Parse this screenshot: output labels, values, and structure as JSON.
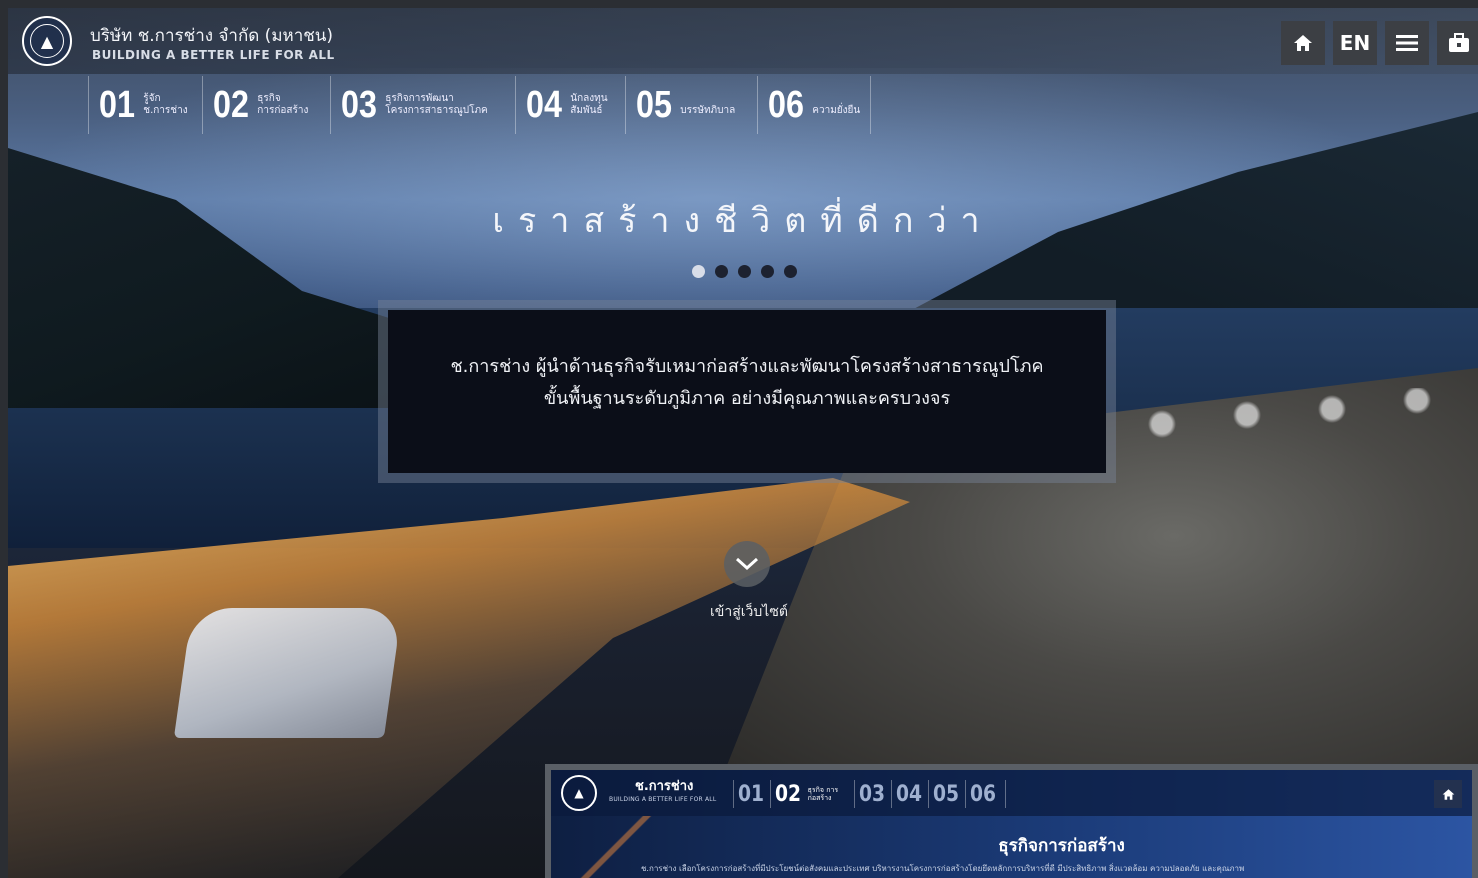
{
  "header": {
    "company_name": "บริษัท ช.การช่าง จำกัด (มหาชน)",
    "tagline": "BUILDING A BETTER LIFE FOR ALL",
    "buttons": {
      "home_icon": "home-icon",
      "lang": "EN",
      "menu_icon": "menu-icon",
      "extra_icon": "briefcase-icon"
    }
  },
  "nav": [
    {
      "num": "01",
      "label_line1": "รู้จัก",
      "label_line2": "ช.การช่าง"
    },
    {
      "num": "02",
      "label_line1": "ธุรกิจ",
      "label_line2": "การก่อสร้าง"
    },
    {
      "num": "03",
      "label_line1": "ธุรกิจการพัฒนา",
      "label_line2": "โครงการสาธารณูปโภค"
    },
    {
      "num": "04",
      "label_line1": "นักลงทุน",
      "label_line2": "สัมพันธ์"
    },
    {
      "num": "05",
      "label_line1": "",
      "label_line2": "บรรษัทภิบาล"
    },
    {
      "num": "06",
      "label_line1": "",
      "label_line2": "ความยั่งยืน"
    }
  ],
  "hero": {
    "headline": "เราสร้างชีวิตที่ดีกว่า",
    "slides": 5,
    "active_slide": 1,
    "quote_line1": "ช.การช่าง ผู้นำด้านธุรกิจรับเหมาก่อสร้างและพัฒนาโครงสร้างสาธารณูปโภค",
    "quote_line2": "ขั้นพื้นฐานระดับภูมิภาค อย่างมีคุณภาพและครบวงจร",
    "enter_label": "เข้าสู่เว็บไซต์"
  },
  "preview": {
    "brand": "ช.การช่าง",
    "tagline": "BUILDING A BETTER LIFE FOR ALL",
    "nav": [
      {
        "num": "01",
        "label": ""
      },
      {
        "num": "02",
        "label": "ธุรกิจ การก่อสร้าง"
      },
      {
        "num": "03",
        "label": ""
      },
      {
        "num": "04",
        "label": ""
      },
      {
        "num": "05",
        "label": ""
      },
      {
        "num": "06",
        "label": ""
      }
    ],
    "title": "ธุรกิจการก่อสร้าง",
    "text": "ช.การช่าง เลือกโครงการก่อสร้างที่มีประโยชน์ต่อสังคมและประเทศ บริหารงานโครงการก่อสร้างโดยยึดหลักการบริหารที่ดี มีประสิทธิภาพ สิ่งแวดล้อม ความปลอดภัย และคุณภาพ"
  }
}
